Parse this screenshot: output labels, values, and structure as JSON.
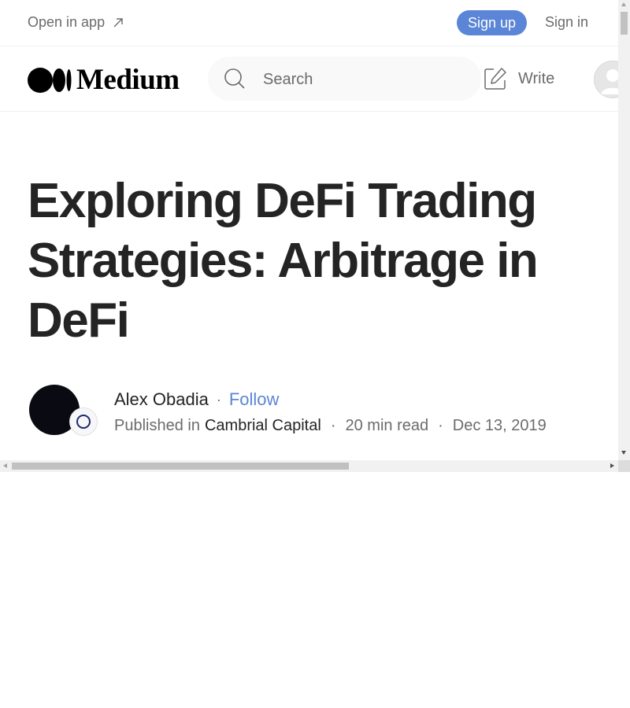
{
  "topbar": {
    "open_in_app": "Open in app",
    "sign_up": "Sign up",
    "sign_in": "Sign in"
  },
  "header": {
    "logo_text": "Medium",
    "search_placeholder": "Search",
    "write_label": "Write"
  },
  "article": {
    "title": "Exploring DeFi Trading Strategies: Arbitrage in DeFi",
    "author_name": "Alex Obadia",
    "follow_label": "Follow",
    "published_in_label": "Published in",
    "publication": "Cambrial Capital",
    "read_time": "20 min read",
    "date": "Dec 13, 2019"
  },
  "colors": {
    "accent": "#5b85d6",
    "text_primary": "#242424",
    "text_secondary": "#6b6b6b"
  },
  "icons": {
    "open_app": "arrow-up-right-icon",
    "search": "search-icon",
    "write": "edit-icon",
    "avatar": "user-avatar-icon"
  }
}
